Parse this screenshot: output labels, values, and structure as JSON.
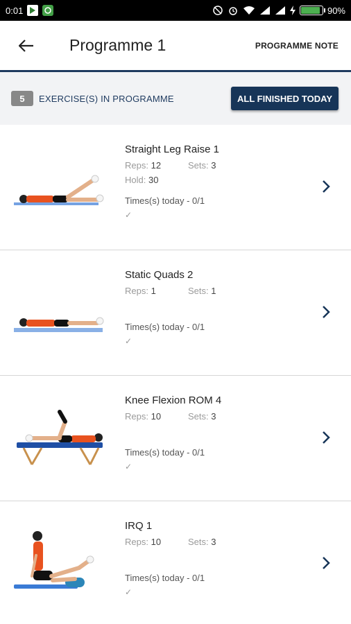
{
  "status_bar": {
    "time": "0:01",
    "battery_percent": "90%",
    "battery_level": 0.9
  },
  "header": {
    "title": "Programme 1",
    "note_label": "PROGRAMME NOTE"
  },
  "summary": {
    "count": "5",
    "label": "EXERCISE(S) IN PROGRAMME",
    "finish_label": "ALL FINISHED TODAY"
  },
  "exercises": [
    {
      "name": "Straight Leg Raise 1",
      "reps_label": "Reps:",
      "reps": "12",
      "sets_label": "Sets:",
      "sets": "3",
      "hold_label": "Hold:",
      "hold": "30",
      "times": "Times(s) today - 0/1",
      "check": "✓"
    },
    {
      "name": "Static Quads 2",
      "reps_label": "Reps:",
      "reps": "1",
      "sets_label": "Sets:",
      "sets": "1",
      "times": "Times(s) today - 0/1",
      "check": "✓"
    },
    {
      "name": "Knee Flexion ROM 4",
      "reps_label": "Reps:",
      "reps": "10",
      "sets_label": "Sets:",
      "sets": "3",
      "times": "Times(s) today - 0/1",
      "check": "✓"
    },
    {
      "name": "IRQ 1",
      "reps_label": "Reps:",
      "reps": "10",
      "sets_label": "Sets:",
      "sets": "3",
      "times": "Times(s) today - 0/1",
      "check": "✓"
    }
  ],
  "colors": {
    "primary": "#173558",
    "accent_line": "#1e3a5f",
    "badge": "#888888"
  }
}
